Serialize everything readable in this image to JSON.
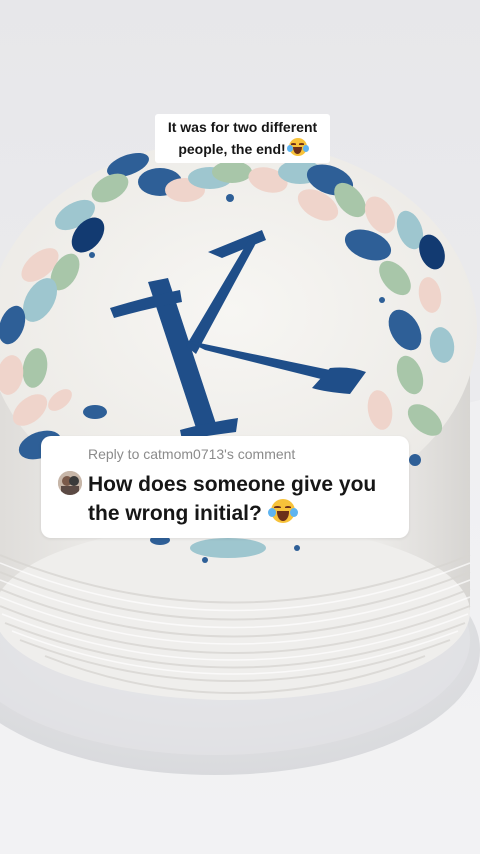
{
  "caption": {
    "line1": "It was for two different",
    "line2": "people, the end!"
  },
  "reply": {
    "label": "Reply to catmom0713's comment",
    "question": "How does someone give you the wrong initial?"
  },
  "cake": {
    "letter": "K",
    "frosting_color": "#f4f2ee",
    "letter_color": "#1f4e89",
    "petal_colors": [
      "#2e5f97",
      "#9ec6cf",
      "#a8c6a9",
      "#efd4cb",
      "#123a71"
    ]
  },
  "icons": {
    "emoji": "face-with-tears-of-joy-icon",
    "avatar": "commenter-avatar"
  }
}
